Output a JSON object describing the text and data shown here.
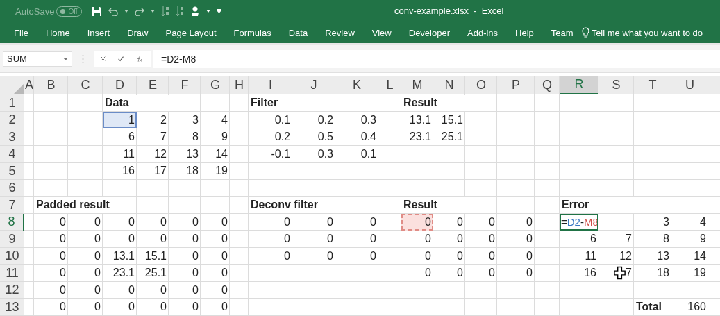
{
  "quick_access": {
    "autosave": {
      "label": "AutoSave",
      "state": "Off",
      "on": false
    }
  },
  "window": {
    "title": "conv-example.xlsx  -  Excel"
  },
  "ribbon_tabs": [
    "File",
    "Home",
    "Insert",
    "Draw",
    "Page Layout",
    "Formulas",
    "Data",
    "Review",
    "View",
    "Developer",
    "Add-ins",
    "Help",
    "Team"
  ],
  "tell_me": {
    "placeholder": "Tell me what you want to do"
  },
  "formula_bar": {
    "name_box": "SUM",
    "formula": "=D2-M8"
  },
  "sheet": {
    "columns": [
      {
        "label": "A",
        "selected": false
      },
      {
        "label": "B",
        "selected": false
      },
      {
        "label": "C",
        "selected": false
      },
      {
        "label": "D",
        "selected": false
      },
      {
        "label": "E",
        "selected": false
      },
      {
        "label": "F",
        "selected": false
      },
      {
        "label": "G",
        "selected": false
      },
      {
        "label": "H",
        "selected": false
      },
      {
        "label": "I",
        "selected": false
      },
      {
        "label": "J",
        "selected": false
      },
      {
        "label": "K",
        "selected": false
      },
      {
        "label": "L",
        "selected": false
      },
      {
        "label": "M",
        "selected": false
      },
      {
        "label": "N",
        "selected": false
      },
      {
        "label": "O",
        "selected": false
      },
      {
        "label": "P",
        "selected": false
      },
      {
        "label": "Q",
        "selected": false
      },
      {
        "label": "R",
        "selected": true
      },
      {
        "label": "S",
        "selected": false
      },
      {
        "label": "T",
        "selected": false
      },
      {
        "label": "U",
        "selected": false
      }
    ],
    "row_headers": [
      {
        "label": "1",
        "selected": false
      },
      {
        "label": "2",
        "selected": false
      },
      {
        "label": "3",
        "selected": false
      },
      {
        "label": "4",
        "selected": false
      },
      {
        "label": "5",
        "selected": false
      },
      {
        "label": "6",
        "selected": false
      },
      {
        "label": "7",
        "selected": false
      },
      {
        "label": "8",
        "selected": true
      },
      {
        "label": "9",
        "selected": false
      },
      {
        "label": "10",
        "selected": false
      },
      {
        "label": "11",
        "selected": false
      },
      {
        "label": "12",
        "selected": false
      },
      {
        "label": "13",
        "selected": false
      }
    ],
    "blocks": [
      {
        "title": "Data",
        "rows": [
          [
            {
              "text": "1",
              "selected": true
            },
            "2",
            "3",
            "4"
          ],
          [
            "6",
            "7",
            "8",
            "9"
          ],
          [
            "11",
            "12",
            "13",
            "14"
          ],
          [
            "16",
            "17",
            "18",
            "19"
          ]
        ]
      },
      {
        "title": "Filter",
        "rows": [
          [
            "0.1",
            "0.2",
            "0.3"
          ],
          [
            "0.2",
            "0.5",
            "0.4"
          ],
          [
            "-0.1",
            "0.3",
            "0.1"
          ]
        ]
      },
      {
        "title": "Result",
        "rows": [
          [
            "13.1",
            "15.1"
          ],
          [
            "23.1",
            "25.1"
          ]
        ]
      },
      {
        "title": "Padded result",
        "rows": [
          [
            "0",
            "0",
            "0",
            "0",
            "0",
            "0"
          ],
          [
            "0",
            "0",
            "0",
            "0",
            "0",
            "0"
          ],
          [
            "0",
            "0",
            "13.1",
            "15.1",
            "0",
            "0"
          ],
          [
            "0",
            "0",
            "23.1",
            "25.1",
            "0",
            "0"
          ],
          [
            "0",
            "0",
            "0",
            "0",
            "0",
            "0"
          ],
          [
            "0",
            "0",
            "0",
            "0",
            "0",
            "0"
          ]
        ]
      },
      {
        "title": "Deconv filter",
        "rows": [
          [
            "0",
            "0",
            "0"
          ],
          [
            "0",
            "0",
            "0"
          ],
          [
            "0",
            "0",
            "0"
          ]
        ]
      },
      {
        "title": "Result",
        "rows": [
          [
            {
              "text": "0",
              "referenced": true
            },
            "0",
            "0",
            "0"
          ],
          [
            "0",
            "0",
            "0",
            "0"
          ],
          [
            "0",
            "0",
            "0",
            "0"
          ],
          [
            "0",
            "0",
            "0",
            "0"
          ]
        ]
      },
      {
        "title": "Error",
        "rows": [
          [
            {
              "kind": "formula",
              "editing": true,
              "parts": [
                {
                  "text": "=",
                  "color": "#222222"
                },
                {
                  "text": "D2",
                  "color": "#3a78c3"
                },
                {
                  "text": "-",
                  "color": "#222222"
                },
                {
                  "text": "M8",
                  "color": "#d0504a"
                }
              ]
            },
            {
              "kind": "blank"
            },
            "3",
            "4"
          ],
          [
            "6",
            "7",
            "8",
            "9"
          ],
          [
            "11",
            "12",
            "13",
            "14"
          ],
          [
            "16",
            {
              "text": "7",
              "pointer": true
            },
            "18",
            "19"
          ]
        ]
      },
      {
        "title": "Total",
        "rows": [
          [
            "160"
          ]
        ]
      }
    ]
  }
}
